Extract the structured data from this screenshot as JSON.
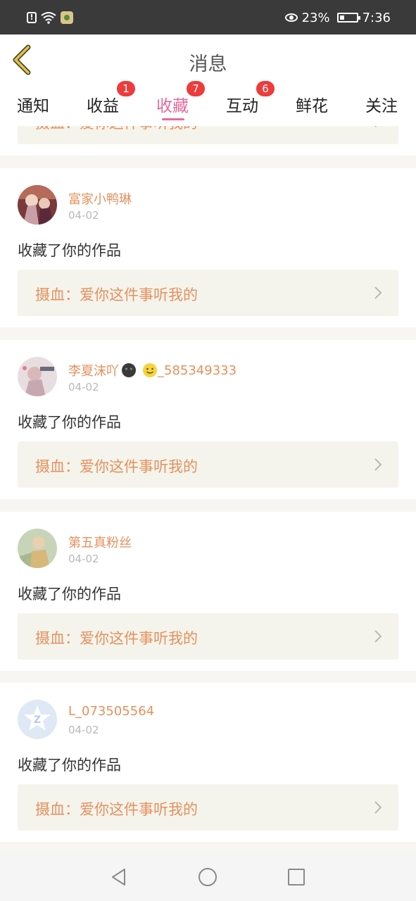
{
  "status_bar": {
    "battery": "23%",
    "time": "7:36"
  },
  "header": {
    "title": "消息",
    "back_icon": "chevron-left-icon"
  },
  "tabs": [
    {
      "label": "通知",
      "badge": ""
    },
    {
      "label": "收益",
      "badge": "1"
    },
    {
      "label": "收藏",
      "badge": "7",
      "active": true
    },
    {
      "label": "互动",
      "badge": "6"
    },
    {
      "label": "鲜花",
      "badge": ""
    },
    {
      "label": "关注",
      "badge": ""
    }
  ],
  "colors": {
    "accent": "#e46a9a",
    "name": "#e4915e",
    "badge": "#ee3b3b",
    "card_link_bg": "#f5f4ec"
  },
  "partial_card": {
    "work_title": "摄血：爱你这件事听我的"
  },
  "items": [
    {
      "username": "富家小鸭琳",
      "date": "04-02",
      "action": "收藏了你的作品",
      "work_title": "摄血：爱你这件事听我的"
    },
    {
      "username": "李夏沫吖",
      "username_suffix": "_585349333",
      "date": "04-02",
      "action": "收藏了你的作品",
      "work_title": "摄血：爱你这件事听我的"
    },
    {
      "username": "第五真粉丝",
      "date": "04-02",
      "action": "收藏了你的作品",
      "work_title": "摄血：爱你这件事听我的"
    },
    {
      "username": "L_073505564",
      "date": "04-02",
      "action": "收藏了你的作品",
      "work_title": "摄血：爱你这件事听我的"
    }
  ],
  "nav_bar": {
    "back_icon": "triangle-back-icon",
    "home_icon": "circle-home-icon",
    "recents_icon": "square-recents-icon"
  }
}
